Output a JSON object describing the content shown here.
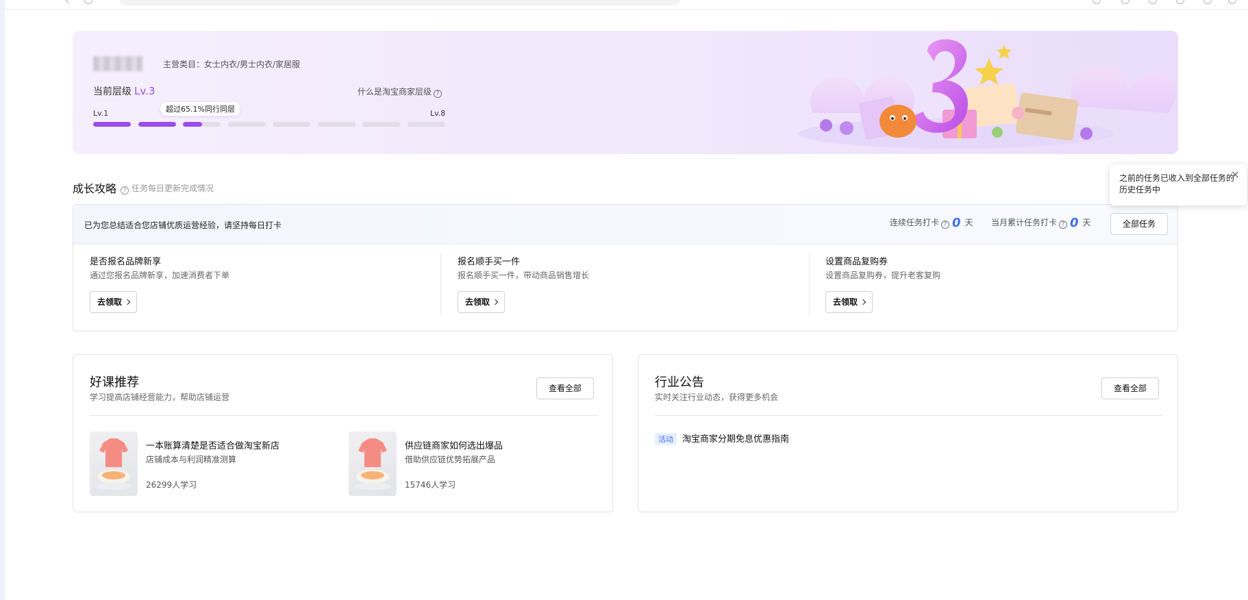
{
  "hero": {
    "category": "主营类目：女士内衣/男士内衣/家居服",
    "level_label": "当前层级",
    "level_value": "Lv.3",
    "what_level": "什么是淘宝商家层级",
    "tooltip": "超过65.1%同行同层",
    "lv_min": "Lv.1",
    "lv_max": "Lv.8",
    "progress_segments": [
      1,
      1,
      0.5,
      0,
      0,
      0,
      0,
      0
    ]
  },
  "growth": {
    "title": "成长攻略",
    "note": "任务每日更新完成情况",
    "popover": "之前的任务已收入到全部任务的历史任务中",
    "close": "×",
    "header_msg": "已为您总结适合您店铺优质运营经验，请坚持每日打卡",
    "streak_label": "连续任务打卡",
    "streak_value": "0",
    "monthly_label": "当月累计任务打卡",
    "monthly_value": "0",
    "day_unit": "天",
    "all_tasks": "全部任务",
    "tasks": [
      {
        "title": "是否报名品牌新享",
        "desc": "通过您报名品牌新享，加速消费者下单",
        "button": "去领取"
      },
      {
        "title": "报名顺手买一件",
        "desc": "报名顺手买一件，带动商品销售增长",
        "button": "去领取"
      },
      {
        "title": "设置商品复购券",
        "desc": "设置商品复购券，提升老客复购",
        "button": "去领取"
      }
    ]
  },
  "courses": {
    "title": "好课推荐",
    "subtitle": "学习提高店铺经营能力，帮助店铺运营",
    "view_all": "查看全部",
    "items": [
      {
        "title": "一本账算清楚是否适合做淘宝新店",
        "desc": "店铺成本与利润精准测算",
        "count": "26299人学习"
      },
      {
        "title": "供应链商家如何选出爆品",
        "desc": "借助供应链优势拓展产品",
        "count": "15746人学习"
      }
    ]
  },
  "announcements": {
    "title": "行业公告",
    "subtitle": "实时关注行业动态，获得更多机会",
    "view_all": "查看全部",
    "items": [
      {
        "tag": "活动",
        "text": "淘宝商家分期免息优惠指南"
      }
    ]
  },
  "colors": {
    "accent": "#9a4dea",
    "blue": "#3e6df2"
  }
}
